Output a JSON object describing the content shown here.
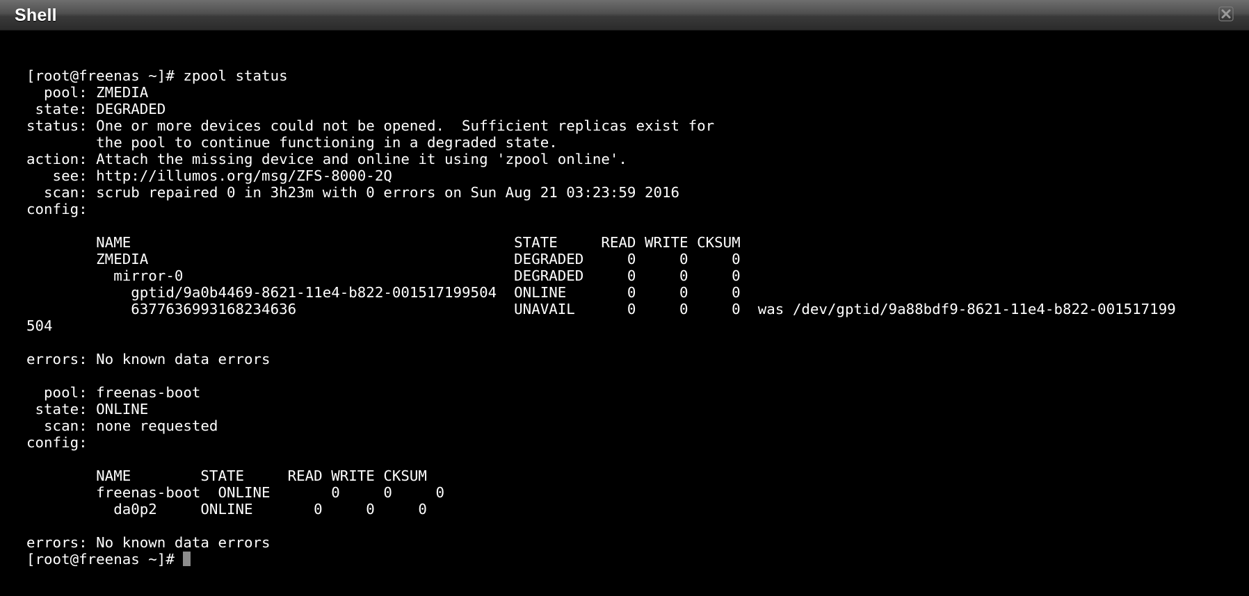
{
  "window": {
    "title": "Shell",
    "close_icon": "close-x-icon"
  },
  "terminal": {
    "lines": [
      "[root@freenas ~]# zpool status",
      "  pool: ZMEDIA",
      " state: DEGRADED",
      "status: One or more devices could not be opened.  Sufficient replicas exist for",
      "        the pool to continue functioning in a degraded state.",
      "action: Attach the missing device and online it using 'zpool online'.",
      "   see: http://illumos.org/msg/ZFS-8000-2Q",
      "  scan: scrub repaired 0 in 3h23m with 0 errors on Sun Aug 21 03:23:59 2016",
      "config:",
      "",
      "        NAME                                            STATE     READ WRITE CKSUM",
      "        ZMEDIA                                          DEGRADED     0     0     0",
      "          mirror-0                                      DEGRADED     0     0     0",
      "            gptid/9a0b4469-8621-11e4-b822-001517199504  ONLINE       0     0     0",
      "            6377636993168234636                         UNAVAIL      0     0     0  was /dev/gptid/9a88bdf9-8621-11e4-b822-001517199",
      "504",
      "",
      "errors: No known data errors",
      "",
      "  pool: freenas-boot",
      " state: ONLINE",
      "  scan: none requested",
      "config:",
      "",
      "        NAME        STATE     READ WRITE CKSUM",
      "        freenas-boot  ONLINE       0     0     0",
      "          da0p2     ONLINE       0     0     0",
      "",
      "errors: No known data errors"
    ],
    "prompt": "[root@freenas ~]# "
  }
}
